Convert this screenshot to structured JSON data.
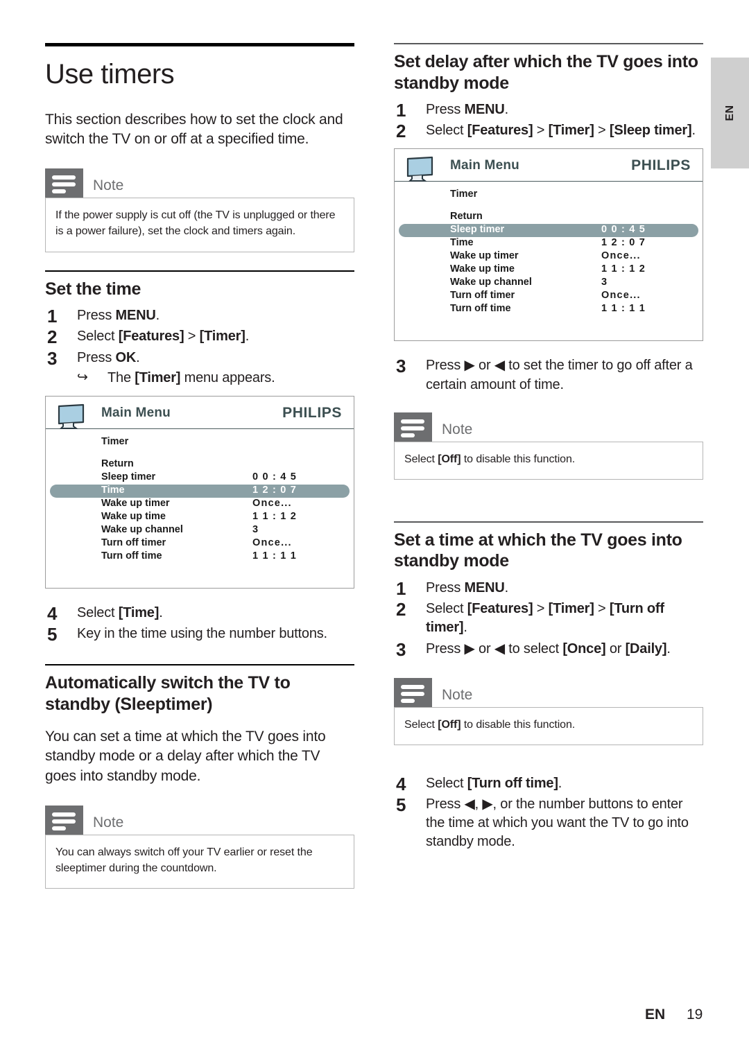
{
  "page": {
    "title": "Use timers",
    "intro": "This section describes how to set the clock and switch the TV on or off at a specified time.",
    "footer_lang": "EN",
    "footer_page": "19",
    "side_tab_label": "EN"
  },
  "note_label": "Note",
  "notes": {
    "power_supply": "If the power supply is cut off (the TV is unplugged or there is a power failure), set the clock and timers again.",
    "sleeptimer": "You can always switch off your TV earlier or reset the sleeptimer during the countdown.",
    "disable_sleep": "Select [Off] to disable this function.",
    "disable_turnoff": "Select [Off] to disable this function."
  },
  "sections": {
    "set_the_time": {
      "heading": "Set the time",
      "steps": [
        {
          "num": "1",
          "text": "Press MENU."
        },
        {
          "num": "2",
          "text": "Select [Features] > [Timer]."
        },
        {
          "num": "3",
          "text": "Press OK."
        }
      ],
      "substep": "The [Timer] menu appears.",
      "steps_after": [
        {
          "num": "4",
          "text": "Select [Time]."
        },
        {
          "num": "5",
          "text": "Key in the time using the number buttons."
        }
      ]
    },
    "sleeptimer": {
      "heading": "Automatically switch the TV to standby (Sleeptimer)",
      "body": "You can set a time at which the TV goes into standby mode or a delay after which the TV goes into standby mode."
    },
    "set_delay": {
      "heading": "Set delay after which the TV goes into standby mode",
      "steps": [
        {
          "num": "1",
          "text": "Press MENU."
        },
        {
          "num": "2",
          "text": "Select [Features] > [Timer] > [Sleep timer]."
        }
      ],
      "step3": {
        "num": "3",
        "text": "Press ▶ or ◀ to set the timer to go off after a certain amount of time."
      }
    },
    "set_standby_time": {
      "heading": "Set a time at which the TV goes into standby mode",
      "steps": [
        {
          "num": "1",
          "text": "Press MENU."
        },
        {
          "num": "2",
          "text": "Select [Features] > [Timer] > [Turn off timer]."
        },
        {
          "num": "3",
          "text": "Press ▶ or ◀ to select [Once] or [Daily]."
        }
      ],
      "steps_after": [
        {
          "num": "4",
          "text": "Select [Turn off time]."
        },
        {
          "num": "5",
          "text": "Press ◀, ▶, or the number buttons to enter the time at which you want the TV to go into standby mode."
        }
      ]
    }
  },
  "tv_menu": {
    "title": "Main Menu",
    "brand": "PHILIPS",
    "submenu": "Timer",
    "return_label": "Return",
    "icon_name": "tv-screen-icon",
    "highlight_color": "#8ba0a5",
    "brand_color": "#3c4f51",
    "rows": [
      {
        "label": "Sleep timer",
        "value": "0 0 : 4 5"
      },
      {
        "label": "Time",
        "value": "1 2 : 0 7"
      },
      {
        "label": "Wake up timer",
        "value": "Once..."
      },
      {
        "label": "Wake up time",
        "value": "1 1 : 1 2"
      },
      {
        "label": "Wake up channel",
        "value": "3"
      },
      {
        "label": "Turn off timer",
        "value": "Once..."
      },
      {
        "label": "Turn off time",
        "value": "1 1 : 1 1"
      }
    ],
    "selected_left": "Time",
    "selected_right": "Sleep timer"
  }
}
